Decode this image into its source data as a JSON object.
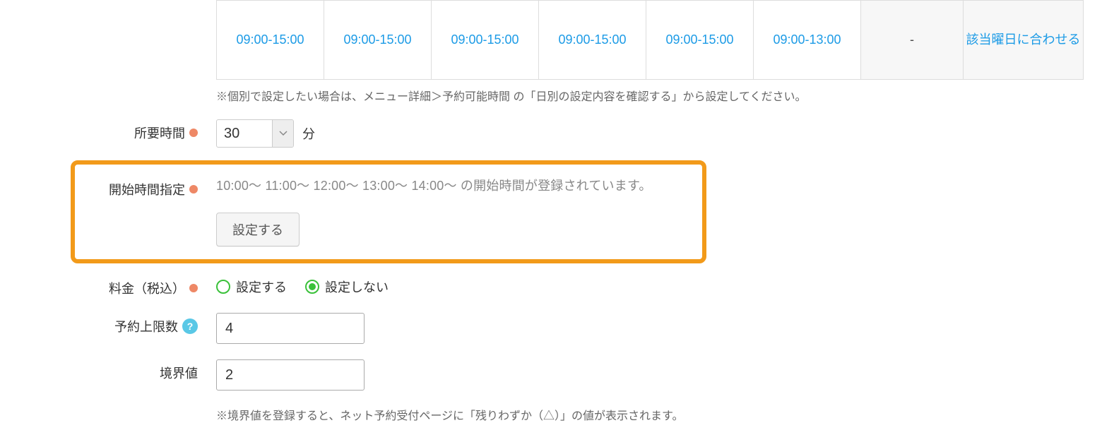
{
  "schedule": {
    "cells": [
      {
        "text": "09:00-15:00",
        "link": true
      },
      {
        "text": "09:00-15:00",
        "link": true
      },
      {
        "text": "09:00-15:00",
        "link": true
      },
      {
        "text": "09:00-15:00",
        "link": true
      },
      {
        "text": "09:00-15:00",
        "link": true
      },
      {
        "text": "09:00-13:00",
        "link": true
      },
      {
        "text": "-",
        "link": false,
        "shaded": true
      },
      {
        "text": "該当曜日に合わせる",
        "message": true,
        "shaded": true
      }
    ],
    "note": "※個別で設定したい場合は、メニュー詳細＞予約可能時間 の「日別の設定内容を確認する」から設定してください。"
  },
  "duration": {
    "label": "所要時間",
    "value": "30",
    "unit": "分"
  },
  "start_time": {
    "label": "開始時間指定",
    "times_text": "10:00～   11:00～   12:00～   13:00～   14:00～   の開始時間が登録されています。",
    "button": "設定する"
  },
  "price": {
    "label": "料金（税込）",
    "opt_set": "設定する",
    "opt_unset": "設定しない"
  },
  "limit": {
    "label": "予約上限数",
    "value": "4"
  },
  "boundary": {
    "label": "境界値",
    "value": "2",
    "note": "※境界値を登録すると、ネット予約受付ページに「残りわずか（△）」の値が表示されます。"
  }
}
